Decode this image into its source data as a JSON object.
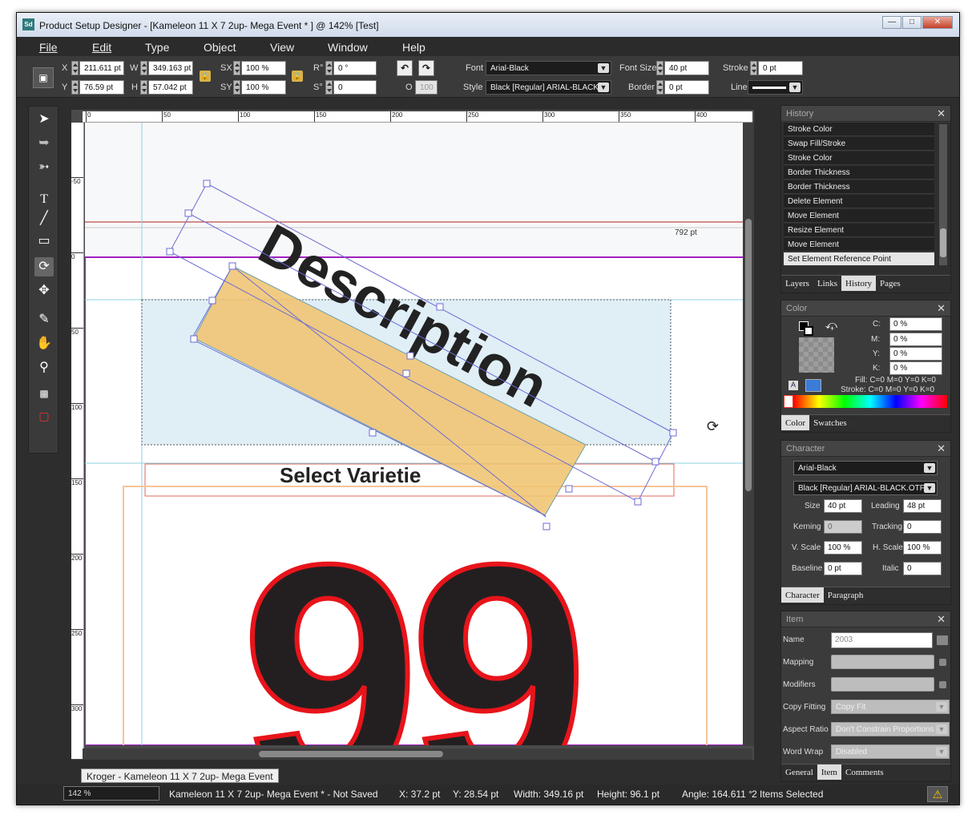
{
  "window": {
    "title": "Product Setup Designer - [Kameleon 11 X 7 2up- Mega Event * ] @ 142% [Test]",
    "app_icon": "Sd",
    "controls": [
      "minimize-icon",
      "maximize-icon",
      "close-icon"
    ]
  },
  "menu": [
    "File",
    "Edit",
    "Type",
    "Object",
    "View",
    "Window",
    "Help"
  ],
  "control_bar": {
    "x_label": "X",
    "x": "211.611 pt",
    "y_label": "Y",
    "y": "76.59 pt",
    "w_label": "W",
    "w": "349.163 pt",
    "h_label": "H",
    "h": "57.042 pt",
    "sx_label": "SX",
    "sx": "100 %",
    "sy_label": "SY",
    "sy": "100 %",
    "rot_label": "R°",
    "rot": "0 °",
    "skew_label": "S°",
    "skew": "0",
    "opacity_label": "O",
    "opacity": "100",
    "font_label": "Font",
    "font": "Arial-Black",
    "style_label": "Style",
    "style": "Black [Regular] ARIAL-BLACK",
    "font_size_label": "Font Size",
    "font_size": "40 pt",
    "border_label": "Border",
    "border": "0 pt",
    "stroke_label": "Stroke",
    "stroke": "0 pt",
    "line_label": "Line"
  },
  "tools": [
    "selection-tool-icon",
    "direct-selection-tool-icon",
    "lasso-tool-icon",
    "text-tool-icon",
    "line-tool-icon",
    "rectangle-tool-icon",
    "rotate-tool-icon",
    "move-tool-icon",
    "eyedropper-tool-icon",
    "hand-tool-icon",
    "zoom-tool-icon",
    "fill-stroke-icon",
    "none-color-icon"
  ],
  "ruler": {
    "top_marks": [
      "0",
      "50",
      "100",
      "150",
      "200",
      "250",
      "300",
      "350",
      "400"
    ],
    "left_marks": [
      "-50",
      "0",
      "50",
      "100",
      "150",
      "200",
      "250",
      "300"
    ]
  },
  "canvas": {
    "guide_label": "792 pt",
    "description_text": "Description",
    "select_text": "Select Varietie",
    "price_text": "99",
    "colors": {
      "background_band": "#f7f8f9",
      "description_box": "#e0eef6",
      "rotated_box": "#f0c471",
      "price_fill": "#231f20",
      "price_stroke": "#e8141b",
      "guide": "#8fd3e0",
      "magenta_border": "#a020c0"
    }
  },
  "document_tab": "Kroger - Kameleon 11 X 7 2up- Mega Event",
  "status": {
    "zoom": "142 %",
    "doc": "Kameleon 11 X 7 2up- Mega Event  * - Not Saved",
    "x": "X: 37.2 pt",
    "y": "Y: 28.54 pt",
    "width": "Width: 349.16 pt",
    "height": "Height: 96.1 pt",
    "angle": "Angle: 164.611 °",
    "selected": "2 Items Selected"
  },
  "history": {
    "title": "History",
    "items": [
      "Stroke Color",
      "Swap Fill/Stroke",
      "Stroke Color",
      "Border Thickness",
      "Border Thickness",
      "Delete Element",
      "Move Element",
      "Resize Element",
      "Move Element",
      "Set Element Reference Point"
    ],
    "tabs": [
      "Layers",
      "Links",
      "History",
      "Pages"
    ]
  },
  "color": {
    "title": "Color",
    "c_label": "C:",
    "c": "0 %",
    "m_label": "M:",
    "m": "0 %",
    "y_label": "Y:",
    "y": "0 %",
    "k_label": "K:",
    "k": "0 %",
    "fill": "Fill: C=0 M=0 Y=0 K=0",
    "stroke": "Stroke: C=0 M=0 Y=0 K=0",
    "tabs": [
      "Color",
      "Swatches"
    ]
  },
  "character": {
    "title": "Character",
    "font": "Arial-Black",
    "style": "Black [Regular] ARIAL-BLACK.OTF",
    "size_label": "Size",
    "size": "40 pt",
    "leading_label": "Leading",
    "leading": "48 pt",
    "kerning_label": "Kerning",
    "kerning": "0",
    "tracking_label": "Tracking",
    "tracking": "0",
    "vscale_label": "V. Scale",
    "vscale": "100 %",
    "hscale_label": "H. Scale",
    "hscale": "100 %",
    "baseline_label": "Baseline",
    "baseline": "0 pt",
    "italic_label": "Italic",
    "italic": "0",
    "tabs": [
      "Character",
      "Paragraph"
    ]
  },
  "item": {
    "title": "Item",
    "name_label": "Name",
    "name": "2003",
    "mapping_label": "Mapping",
    "modifiers_label": "Modifiers",
    "copy_fitting_label": "Copy Fitting",
    "copy_fitting": "Copy Fit",
    "aspect_label": "Aspect Ratio",
    "aspect": "Don't Constrain Proportions",
    "wrap_label": "Word Wrap",
    "wrap": "Disabled",
    "tabs": [
      "General",
      "Item",
      "Comments"
    ]
  }
}
